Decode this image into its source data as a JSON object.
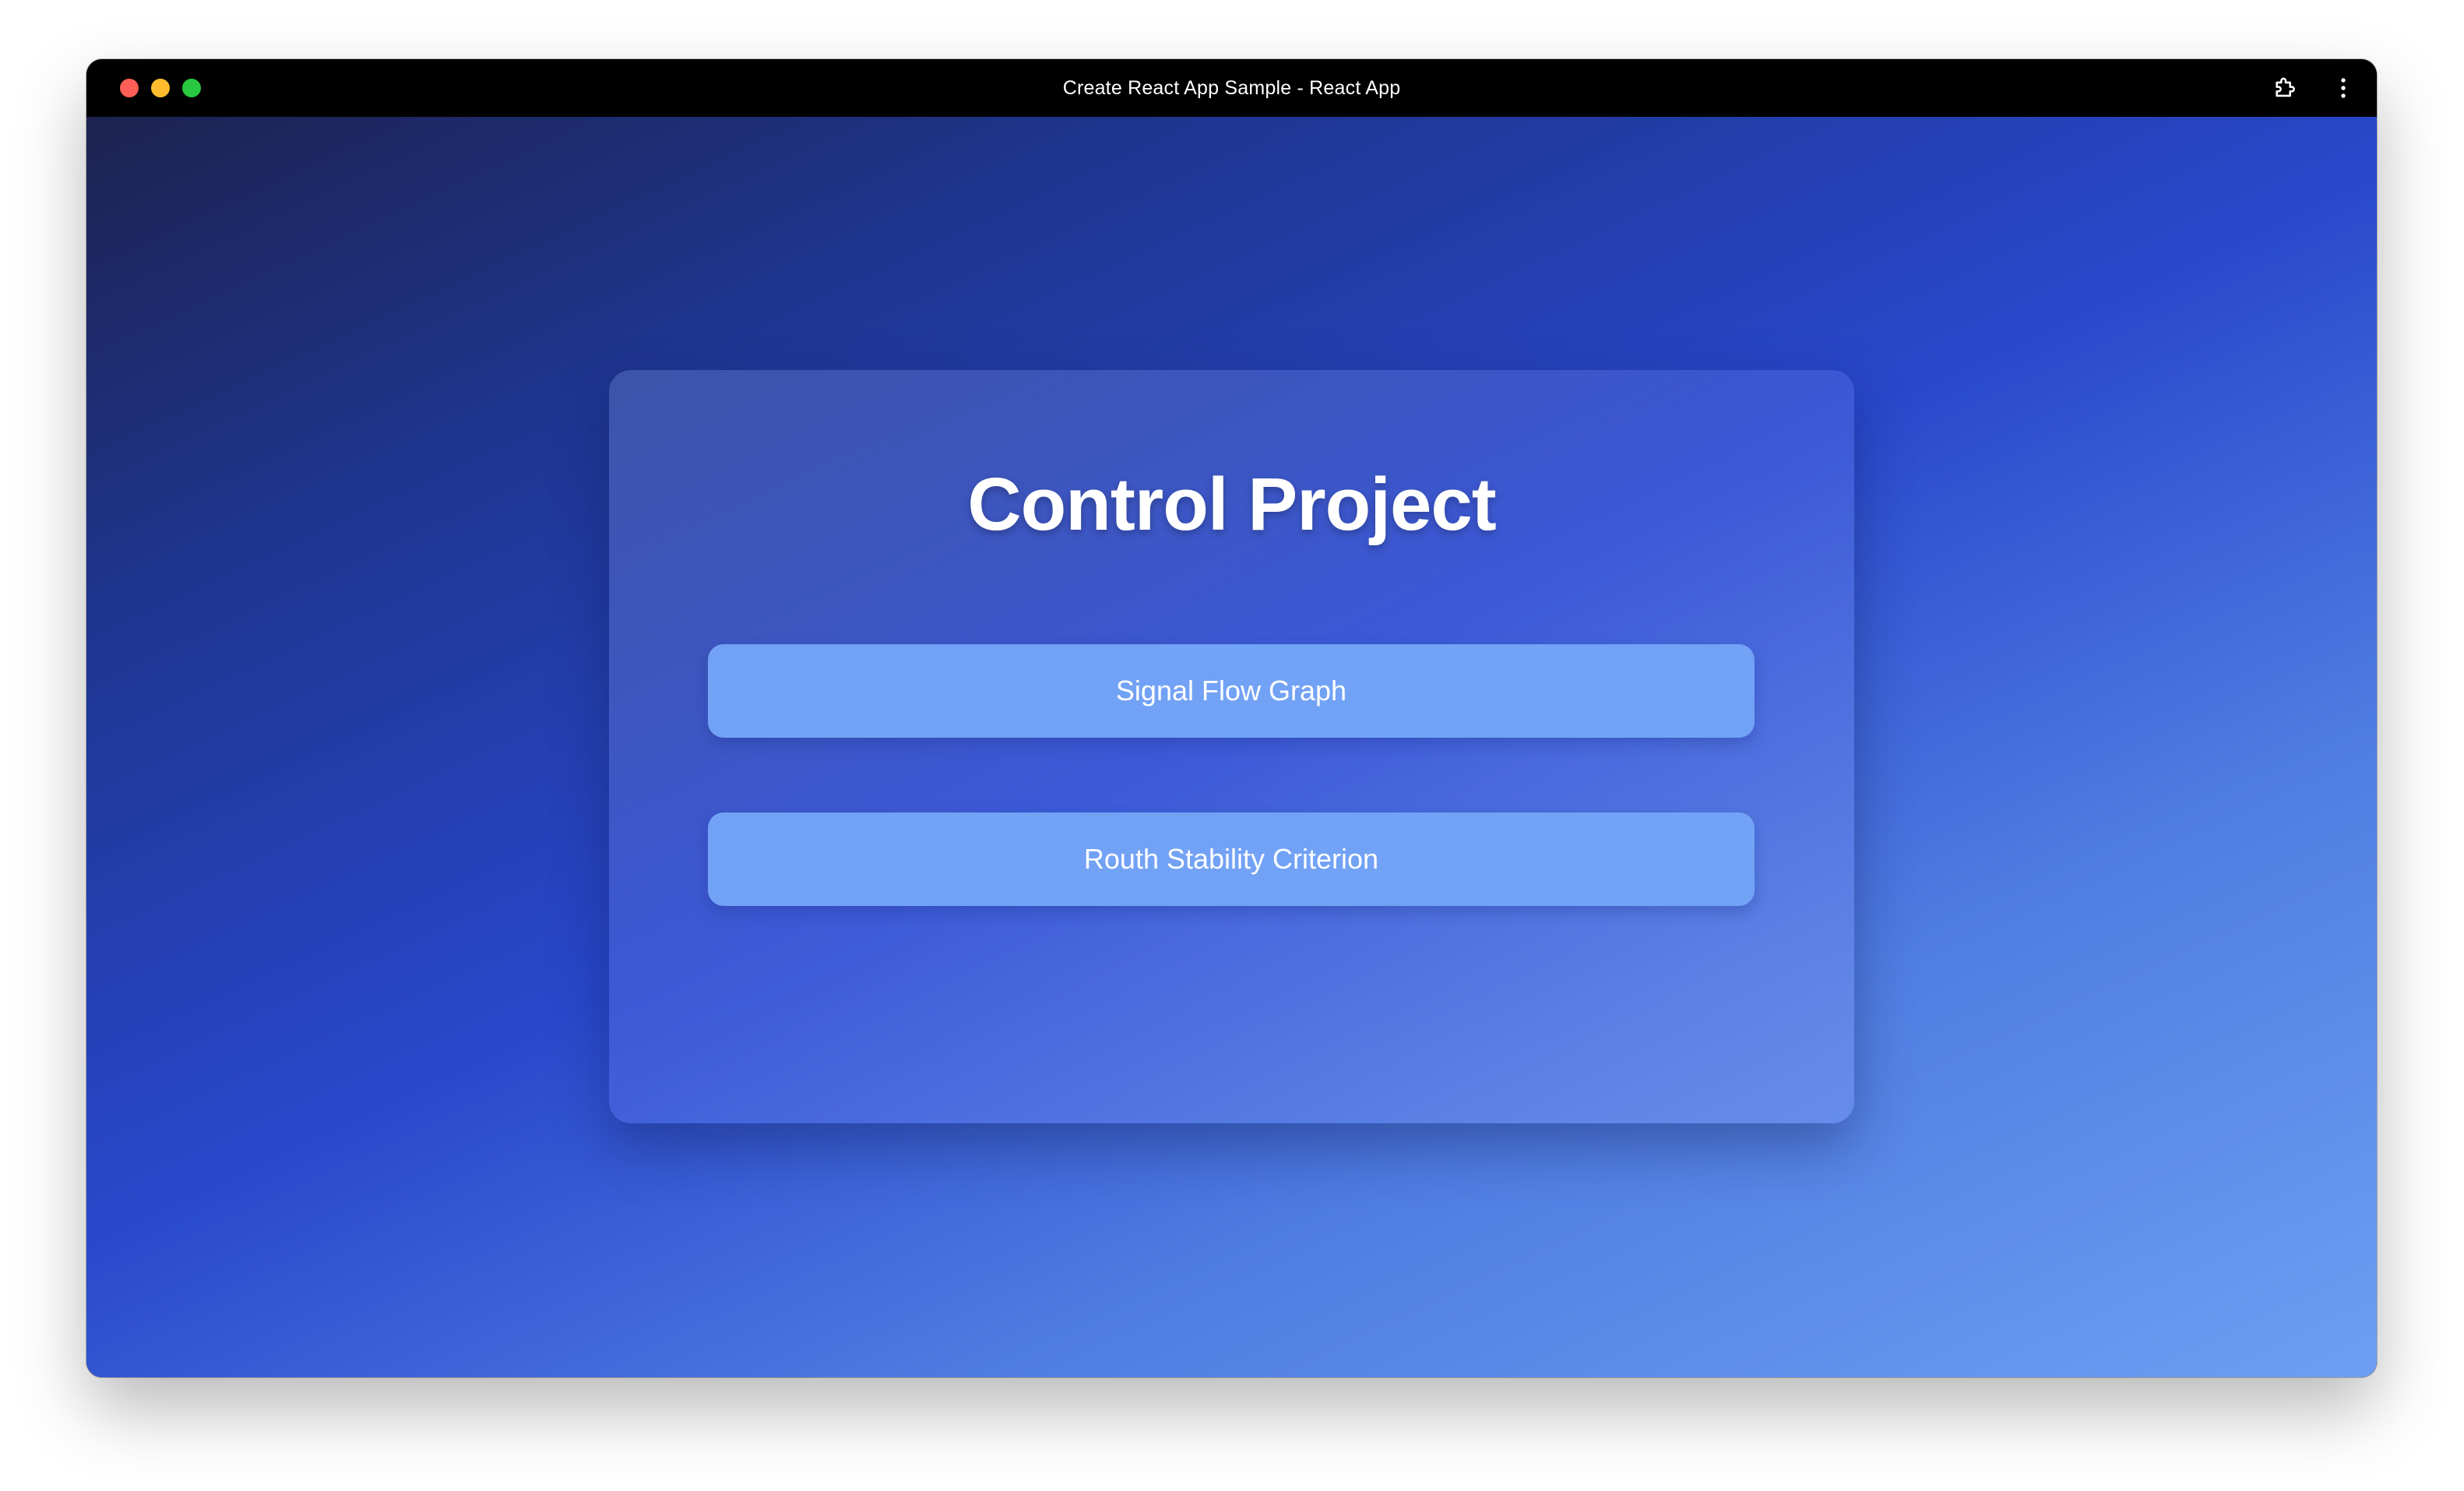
{
  "browser": {
    "title": "Create React App Sample - React App",
    "icons": [
      "extensions-icon",
      "more-menu-icon"
    ]
  },
  "page": {
    "heading": "Control Project",
    "buttons": [
      {
        "label": "Signal Flow Graph"
      },
      {
        "label": "Routh Stability Criterion"
      }
    ]
  },
  "colors": {
    "titlebar": "#000000",
    "button": "#72a2f5",
    "gradient_start": "#1c2350",
    "gradient_mid": "#2848cc",
    "gradient_end": "#6e9ff2"
  }
}
